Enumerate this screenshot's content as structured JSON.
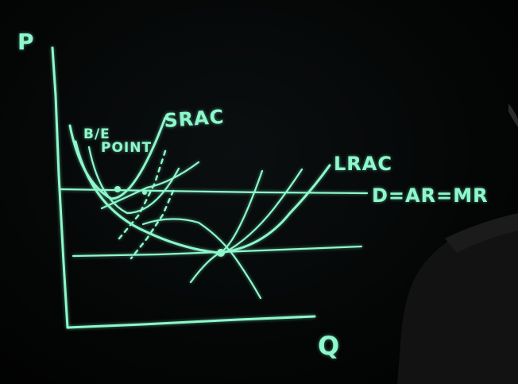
{
  "colors": {
    "ink": "#8ff7cc",
    "background": "#000000",
    "presenter": "#141414"
  },
  "labels": {
    "price_axis": "P",
    "quantity_axis": "Q",
    "srac": "SRAC",
    "lrac": "LRAC",
    "demand": "D=AR=MR",
    "be_line1": "B/E",
    "be_line2": "POINT"
  }
}
